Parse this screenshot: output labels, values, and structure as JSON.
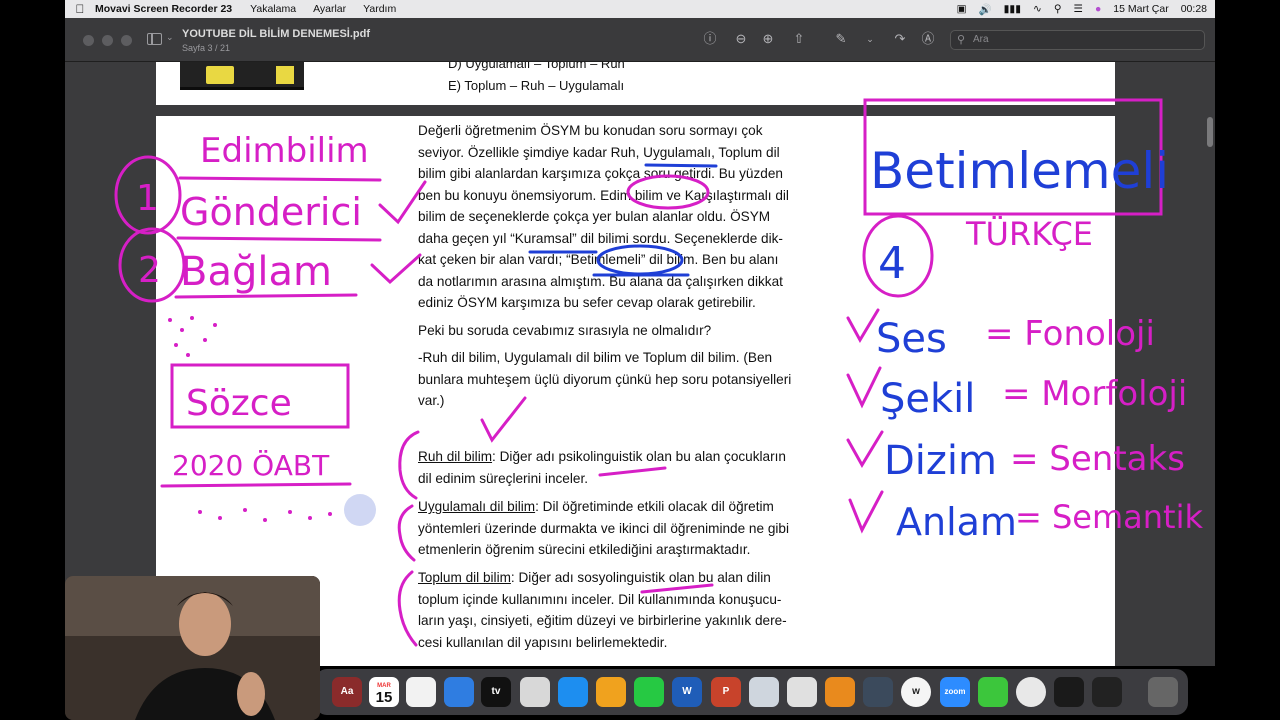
{
  "menubar": {
    "app_name": "Movavi Screen Recorder 23",
    "menus": [
      "Yakalama",
      "Ayarlar",
      "Yardım"
    ],
    "date": "15 Mart Çar",
    "time": "00:28"
  },
  "window": {
    "title": "YOUTUBE DİL BİLİM DENEMESİ.pdf",
    "subtitle": "Sayfa 3 / 21",
    "search_placeholder": "Ara"
  },
  "page_top": {
    "option_d": "D) Uygulamalı – Toplum – Ruh",
    "option_e": "E) Toplum – Ruh – Uygulamalı"
  },
  "page_main": {
    "p1_lines": [
      "Değerli öğretmenim ÖSYM bu konudan soru sormayı çok",
      "seviyor. Özellikle şimdiye kadar Ruh, Uygulamalı, Toplum dil",
      "bilim gibi alanlardan karşımıza çokça soru getirdi. Bu yüzden",
      "ben bu konuyu önemsiyorum. Edim bilim ve Karşılaştırmalı dil",
      "bilim de seçeneklerde çokça yer bulan alanlar oldu. ÖSYM",
      "daha geçen yıl “Kuramsal” dil bilimi sordu. Seçeneklerde dik-",
      "kat çeken bir alan vardı; “Betimlemeli” dil bilim. Ben bu alanı",
      "da notlarımın arasına almıştım. Bu alana da çalışırken dikkat",
      "ediniz ÖSYM karşımıza bu sefer cevap olarak getirebilir."
    ],
    "question": "Peki bu soruda cevabımız sırasıyla ne olmalıdır?",
    "answer_lines": [
      "-Ruh dil bilim, Uygulamalı dil bilim ve Toplum dil bilim. (Ben",
      "bunlara muhteşem üçlü diyorum çünkü hep soru potansiyelleri",
      "var.)"
    ],
    "def1_term": "Ruh dil bilim",
    "def1_lines": [
      ": Diğer adı psikolinguistik olan bu alan çocukların",
      "dil edinim süreçlerini inceler."
    ],
    "def2_term": "Uygulamalı dil bilim",
    "def2_lines": [
      ": Dil öğretiminde etkili olacak dil öğretim",
      "yöntemleri üzerinde durmakta ve ikinci dil öğreniminde ne gibi",
      "etmenlerin öğrenim sürecini etkilediğini araştırmaktadır."
    ],
    "def3_term": "Toplum dil bilim",
    "def3_lines": [
      ": Diğer adı sosyolinguistik olan bu alan dilin",
      "toplum içinde kullanımını inceler. Dil kullanımında konuşucu-",
      "ların yaşı, cinsiyeti, eğitim düzeyi ve birbirlerine yakınlık dere-",
      "cesi kullanılan dil yapısını belirlemektedir."
    ]
  },
  "handwriting": {
    "edimbilim": "Edimbilim",
    "n1": "1",
    "gonderici": "Gönderici",
    "n2": "2",
    "baglam": "Bağlam",
    "sozce": "Sözce",
    "oabt": "2020 ÖABT",
    "betimlemeli": "Betimlemeli",
    "n4": "4",
    "turkce": "TÜRKÇE",
    "ses": "Ses",
    "fonoloji": "= Fonoloji",
    "sekil": "Şekil",
    "morfoloji": "= Morfoloji",
    "dizim": "Dizim",
    "sentaks": "= Sentaks",
    "anlam": "Anlam",
    "semantik": "= Semantik"
  },
  "dock": {
    "calendar_month": "MAR",
    "calendar_day": "15",
    "dictionary_label": "Aa",
    "tv_label": "tv",
    "zoom_label": "zoom",
    "w_label": "W",
    "p_label": "P"
  },
  "colors": {
    "magenta_ink": "#d61fc6",
    "blue_ink": "#1f3fd6"
  }
}
